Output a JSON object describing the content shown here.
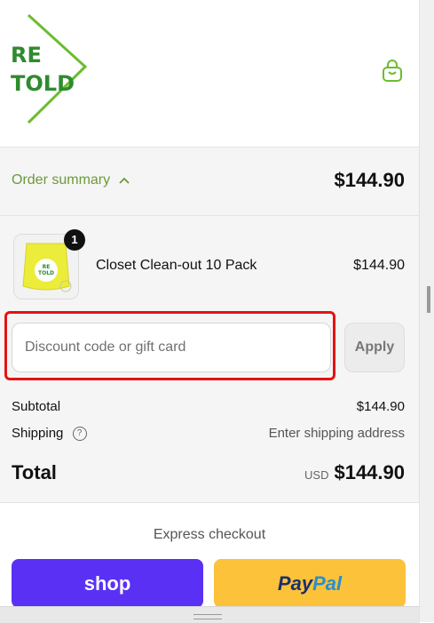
{
  "brand": {
    "name_line1": "RE",
    "name_line2": "TOLD",
    "color": "#6bbd2f"
  },
  "header": {
    "cart_icon": "shopping-bag-icon"
  },
  "summary": {
    "toggle_label": "Order summary",
    "toggle_icon": "chevron-up-icon",
    "total": "$144.90"
  },
  "cart": {
    "items": [
      {
        "name": "Closet Clean-out 10 Pack",
        "price": "$144.90",
        "quantity": "1",
        "thumb_logo_line1": "RE",
        "thumb_logo_line2": "TOLD"
      }
    ]
  },
  "discount": {
    "placeholder": "Discount code or gift card",
    "apply_label": "Apply"
  },
  "totals": {
    "subtotal_label": "Subtotal",
    "subtotal_value": "$144.90",
    "shipping_label": "Shipping",
    "shipping_value": "Enter shipping address",
    "help_icon": "?",
    "total_label": "Total",
    "currency": "USD",
    "total_value": "$144.90"
  },
  "express": {
    "title": "Express checkout",
    "shop_label": "shop",
    "paypal_pay": "Pay",
    "paypal_pal": "Pal"
  },
  "colors": {
    "accent": "#6b9a3a",
    "highlight": "#e41313",
    "shop": "#5a31f4",
    "paypal": "#fcc23a"
  }
}
